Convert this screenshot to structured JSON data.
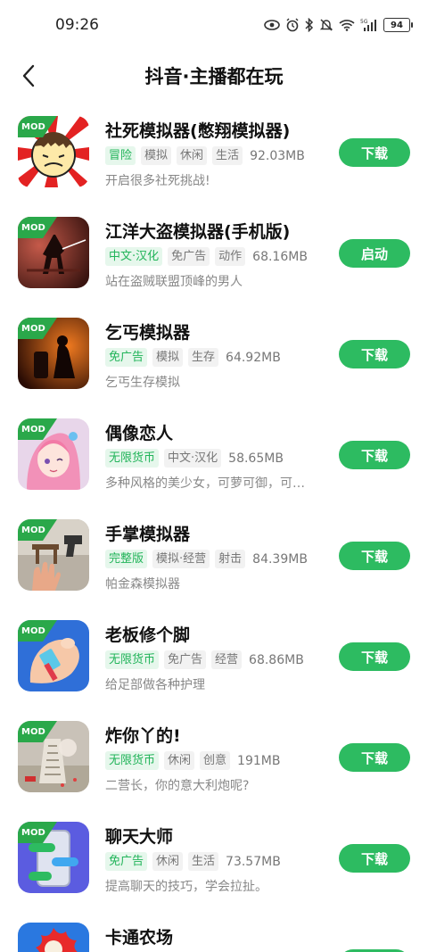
{
  "status_bar": {
    "time": "09:26",
    "battery": "94",
    "icons": [
      "eye-icon",
      "alarm-icon",
      "bluetooth-icon",
      "mute-icon",
      "wifi-icon",
      "signal-5g-icon",
      "battery-icon"
    ]
  },
  "header": {
    "title": "抖音·主播都在玩",
    "back_icon": "chevron-left-icon"
  },
  "badge_label": "MOD",
  "colors": {
    "accent": "#2dbb61",
    "accent_tag_bg": "#e6f7ec",
    "tag_text": "#777777"
  },
  "apps": [
    {
      "name": "社死模拟器(憋翔模拟器)",
      "tags": [
        {
          "text": "冒险",
          "green": true
        },
        {
          "text": "模拟",
          "green": false
        },
        {
          "text": "休闲",
          "green": false
        },
        {
          "text": "生活",
          "green": false
        }
      ],
      "size": "92.03MB",
      "desc": "开启很多社死挑战!",
      "button": "下载"
    },
    {
      "name": "江洋大盗模拟器(手机版)",
      "tags": [
        {
          "text": "中文·汉化",
          "green": true
        },
        {
          "text": "免广告",
          "green": false
        },
        {
          "text": "动作",
          "green": false
        }
      ],
      "size": "68.16MB",
      "desc": "站在盗贼联盟顶峰的男人",
      "button": "启动"
    },
    {
      "name": "乞丐模拟器",
      "tags": [
        {
          "text": "免广告",
          "green": true
        },
        {
          "text": "模拟",
          "green": false
        },
        {
          "text": "生存",
          "green": false
        }
      ],
      "size": "64.92MB",
      "desc": "乞丐生存模拟",
      "button": "下载"
    },
    {
      "name": "偶像恋人",
      "tags": [
        {
          "text": "无限货币",
          "green": true
        },
        {
          "text": "中文·汉化",
          "green": false
        }
      ],
      "size": "58.65MB",
      "desc": "多种风格的美少女，可萝可御，可…",
      "button": "下载"
    },
    {
      "name": "手掌模拟器",
      "tags": [
        {
          "text": "完整版",
          "green": true
        },
        {
          "text": "模拟·经营",
          "green": false
        },
        {
          "text": "射击",
          "green": false
        }
      ],
      "size": "84.39MB",
      "desc": "帕金森模拟器",
      "button": "下载"
    },
    {
      "name": "老板修个脚",
      "tags": [
        {
          "text": "无限货币",
          "green": true
        },
        {
          "text": "免广告",
          "green": false
        },
        {
          "text": "经营",
          "green": false
        }
      ],
      "size": "68.86MB",
      "desc": "给足部做各种护理",
      "button": "下载"
    },
    {
      "name": "炸你丫的!",
      "tags": [
        {
          "text": "无限货币",
          "green": true
        },
        {
          "text": "休闲",
          "green": false
        },
        {
          "text": "创意",
          "green": false
        }
      ],
      "size": "191MB",
      "desc": "二营长，你的意大利炮呢?",
      "button": "下载"
    },
    {
      "name": "聊天大师",
      "tags": [
        {
          "text": "免广告",
          "green": true
        },
        {
          "text": "休闲",
          "green": false
        },
        {
          "text": "生活",
          "green": false
        }
      ],
      "size": "73.57MB",
      "desc": "提高聊天的技巧，学会拉扯。",
      "button": "下载"
    },
    {
      "name": "卡通农场",
      "tags": [],
      "size": "",
      "desc": "",
      "button": ""
    }
  ]
}
